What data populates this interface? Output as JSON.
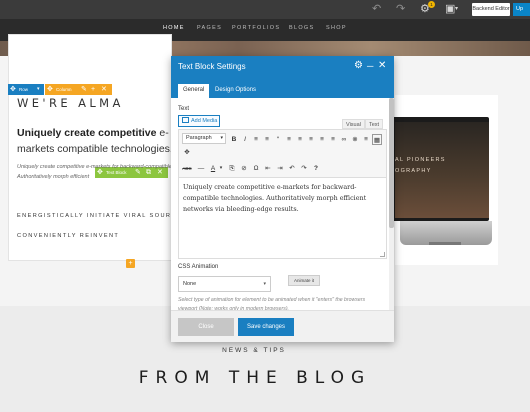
{
  "admin_bar": {
    "backend_editor_label": "Backend Editor",
    "update_label": "Up",
    "notification_count": "1"
  },
  "site_nav": {
    "items": [
      "HOME",
      "PAGES",
      "PORTFOLIOS",
      "BLOGS",
      "SHOP"
    ],
    "active_index": 0
  },
  "page": {
    "brand": "WE'RE ALMA",
    "headline_bold": "Uniquely create competitive",
    "headline_rest": " e-markets compatible technologies.",
    "small_text": "Uniquely create competitive e-markets for backward-compatible Authoritatively morph efficient",
    "caps_line_1": "ENERGISTICALLY INITIATE VIRAL SOURCES",
    "caps_line_2": "CONVENIENTLY REINVENT",
    "monitor_line_1": "AL PIONEERS",
    "monitor_line_2": "OGRAPHY",
    "news_tips": "NEWS & TIPS",
    "from_blog": "FROM THE BLOG"
  },
  "controls": {
    "row_label": "Row",
    "column_label": "Column",
    "text_block_label": "Text Block",
    "row_color": "#1a7fc1",
    "column_color": "#f5a623",
    "text_block_color": "#8cc63f"
  },
  "modal": {
    "title": "Text Block Settings",
    "tabs": [
      "General",
      "Design Options"
    ],
    "active_tab": "General",
    "text_label": "Text",
    "add_media_label": "Add Media",
    "mode_tabs": [
      "Visual",
      "Text"
    ],
    "format_select": "Paragraph",
    "toolbar_row1": [
      "B",
      "I",
      "≡",
      "≡",
      "“",
      "≡",
      "≡",
      "≡",
      "≡",
      "≡",
      "∞",
      "⊗",
      "≡",
      "▦"
    ],
    "toolbar_row2": [
      "ABC",
      "—",
      "A",
      "▾",
      "⎘",
      "⊘",
      "Ω",
      "⇤",
      "⇥",
      "↶",
      "↷",
      "?"
    ],
    "editor_text": "Uniquely create competitive e-markets for backward-compatible technologies. Authoritatively morph efficient networks via bleeding-edge results.",
    "css_animation_label": "CSS Animation",
    "animation_value": "None",
    "animate_button": "Animate it",
    "animation_help": "Select type of animation for element to be animated when it \"enters\" the browsers viewport (Note: works only in modern browsers).",
    "close_button": "Close",
    "save_button": "Save changes",
    "accent_color": "#1a7fc1"
  }
}
